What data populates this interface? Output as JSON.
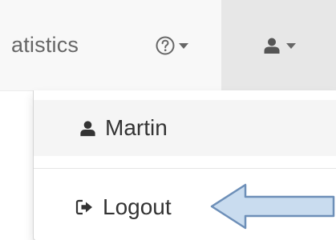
{
  "navbar": {
    "statistics_label": "atistics",
    "help_icon": "question-circle-icon",
    "user_icon": "user-icon"
  },
  "dropdown": {
    "user_name": "Martin",
    "logout_label": "Logout",
    "logout_icon": "sign-out-icon"
  },
  "annotation": {
    "arrow_fill": "#c9dcef",
    "arrow_stroke": "#6d8fb8"
  },
  "colors": {
    "navbar_bg": "#f8f8f8",
    "active_nav_bg": "#e7e7e7",
    "hover_item_bg": "#f5f5f5",
    "text": "#333333",
    "muted_text": "#666666"
  }
}
